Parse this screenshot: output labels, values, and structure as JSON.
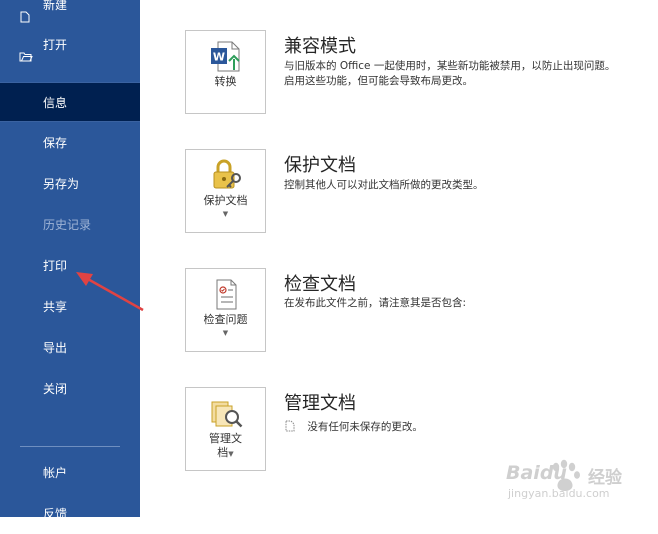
{
  "sidebar": {
    "items": [
      {
        "label": "新建",
        "state": "normal",
        "icon": "new-document-icon"
      },
      {
        "label": "打开",
        "state": "normal",
        "icon": "folder-open-icon"
      },
      {
        "label": "信息",
        "state": "active"
      },
      {
        "label": "保存",
        "state": "normal"
      },
      {
        "label": "另存为",
        "state": "normal"
      },
      {
        "label": "历史记录",
        "state": "disabled"
      },
      {
        "label": "打印",
        "state": "normal"
      },
      {
        "label": "共享",
        "state": "normal"
      },
      {
        "label": "导出",
        "state": "normal"
      },
      {
        "label": "关闭",
        "state": "normal"
      },
      {
        "label": "帐户",
        "state": "normal"
      },
      {
        "label": "反馈",
        "state": "normal"
      }
    ]
  },
  "sections": {
    "compat": {
      "button_label": "转换",
      "title": "兼容模式",
      "desc_line1": "与旧版本的 Office 一起使用时，某些新功能被禁用，以防止出现问题。",
      "desc_line2": "启用这些功能，但可能会导致布局更改。"
    },
    "protect": {
      "button_label": "保护文档",
      "title": "保护文档",
      "desc": "控制其他人可以对此文档所做的更改类型。"
    },
    "inspect": {
      "button_label": "检查问题",
      "title": "检查文档",
      "desc": "在发布此文件之前，请注意其是否包含:"
    },
    "manage": {
      "button_label_line1": "管理文",
      "button_label_line2": "档",
      "title": "管理文档",
      "desc": "没有任何未保存的更改。"
    }
  },
  "watermark": {
    "brand": "Baidu",
    "brand_cn": "经验",
    "url": "jingyan.baidu.com"
  },
  "colors": {
    "sidebar": "#2b579a",
    "sidebar_active": "#002050",
    "annotation_arrow": "#e04343",
    "word_blue": "#2b579a"
  }
}
